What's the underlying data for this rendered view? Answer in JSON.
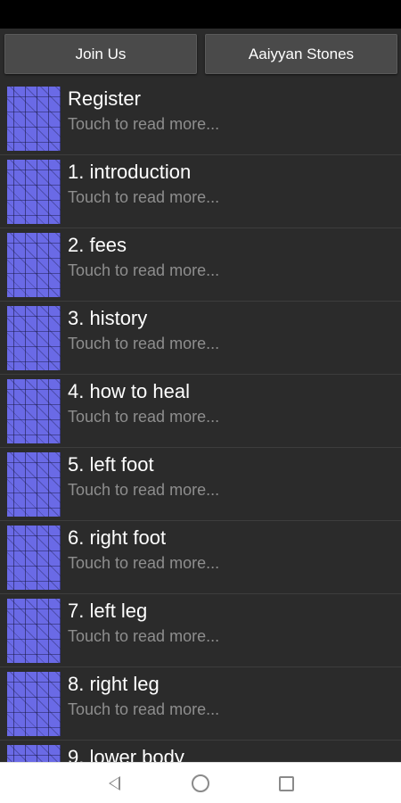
{
  "top_buttons": {
    "left_label": "Join Us",
    "right_label": "Aaiyyan Stones"
  },
  "list": {
    "items": [
      {
        "title": "Register",
        "subtitle": "Touch to read more..."
      },
      {
        "title": "1. introduction",
        "subtitle": "Touch to read more..."
      },
      {
        "title": "2. fees",
        "subtitle": "Touch to read more..."
      },
      {
        "title": "3. history",
        "subtitle": "Touch to read more..."
      },
      {
        "title": "4. how to heal",
        "subtitle": "Touch to read more..."
      },
      {
        "title": "5. left foot",
        "subtitle": "Touch to read more..."
      },
      {
        "title": "6. right foot",
        "subtitle": "Touch to read more..."
      },
      {
        "title": "7. left leg",
        "subtitle": "Touch to read more..."
      },
      {
        "title": "8. right leg",
        "subtitle": "Touch to read more..."
      },
      {
        "title": "9. lower body",
        "subtitle": ""
      }
    ]
  },
  "nav": {
    "back_icon": "back-triangle-icon",
    "home_icon": "home-circle-icon",
    "recent_icon": "recents-square-icon"
  },
  "colors": {
    "background": "#2b2b2b",
    "button": "#4a4a4a",
    "thumbnail": "#6a6ae6",
    "subtitle": "#8e8e8e"
  }
}
